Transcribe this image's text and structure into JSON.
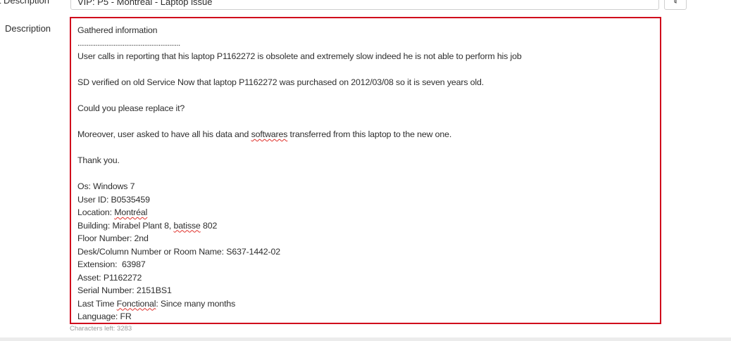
{
  "short_description": {
    "label": "t Description",
    "value": "VIP: P5 - Montreal - Laptop issue",
    "lookup_icon": "suggestion-icon"
  },
  "description": {
    "label": "Description",
    "lines": [
      "Gathered information",
      ".........................................................",
      "User calls in reporting that his laptop P1162272 is obsolete and extremely slow indeed he is not able to perform his job",
      "",
      "SD verified on old Service Now that laptop P1162272 was purchased on 2012/03/08 so it is seven years old.",
      "",
      "Could you please replace it?",
      "",
      "Moreover, user asked to have all his data and softwares transferred from this laptop to the new one.",
      "",
      "Thank you.",
      "",
      "Os: Windows 7",
      "User ID: B0535459",
      "Location: Montréal",
      "Building: Mirabel Plant 8, batisse 802",
      "Floor Number: 2nd",
      "Desk/Column Number or Room Name: S637-1442-02",
      "Extension:  63987",
      "Asset: P1162272",
      "Serial Number: 2151BS1",
      "Last Time Fonctional: Since many months",
      "Language: FR"
    ],
    "highlight_color": "#d0021b"
  },
  "characters_left": "Characters left: 3283"
}
